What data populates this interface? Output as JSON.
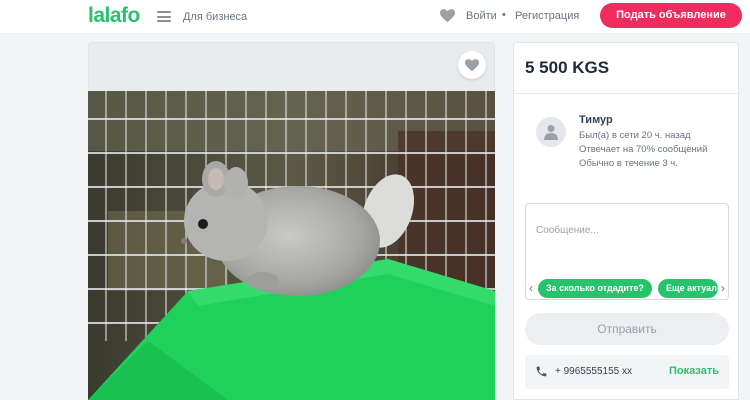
{
  "header": {
    "logo": "lalafo",
    "business_link": "Для бизнеса",
    "login": "Войти",
    "separator": "•",
    "register": "Регистрация",
    "post_button": "Подать объявление",
    "accent_color": "#27c26c",
    "brand_button_color": "#ef2b5f"
  },
  "listing": {
    "price": "5 500 KGS",
    "photo": "chinchilla-in-cage"
  },
  "seller": {
    "name": "Тимур",
    "last_seen": "Был(а) в сети 20 ч. назад",
    "response_rate": "Отвечает на 70% сообщений",
    "response_time": "Обычно в течение 3 ч."
  },
  "message": {
    "placeholder": "Сообщение...",
    "quick_replies": [
      "За сколько отдадите?",
      "Еще актуально?"
    ],
    "send_button": "Отправить"
  },
  "phone": {
    "number": "+ 9965555155 xx",
    "show_button": "Показать"
  }
}
